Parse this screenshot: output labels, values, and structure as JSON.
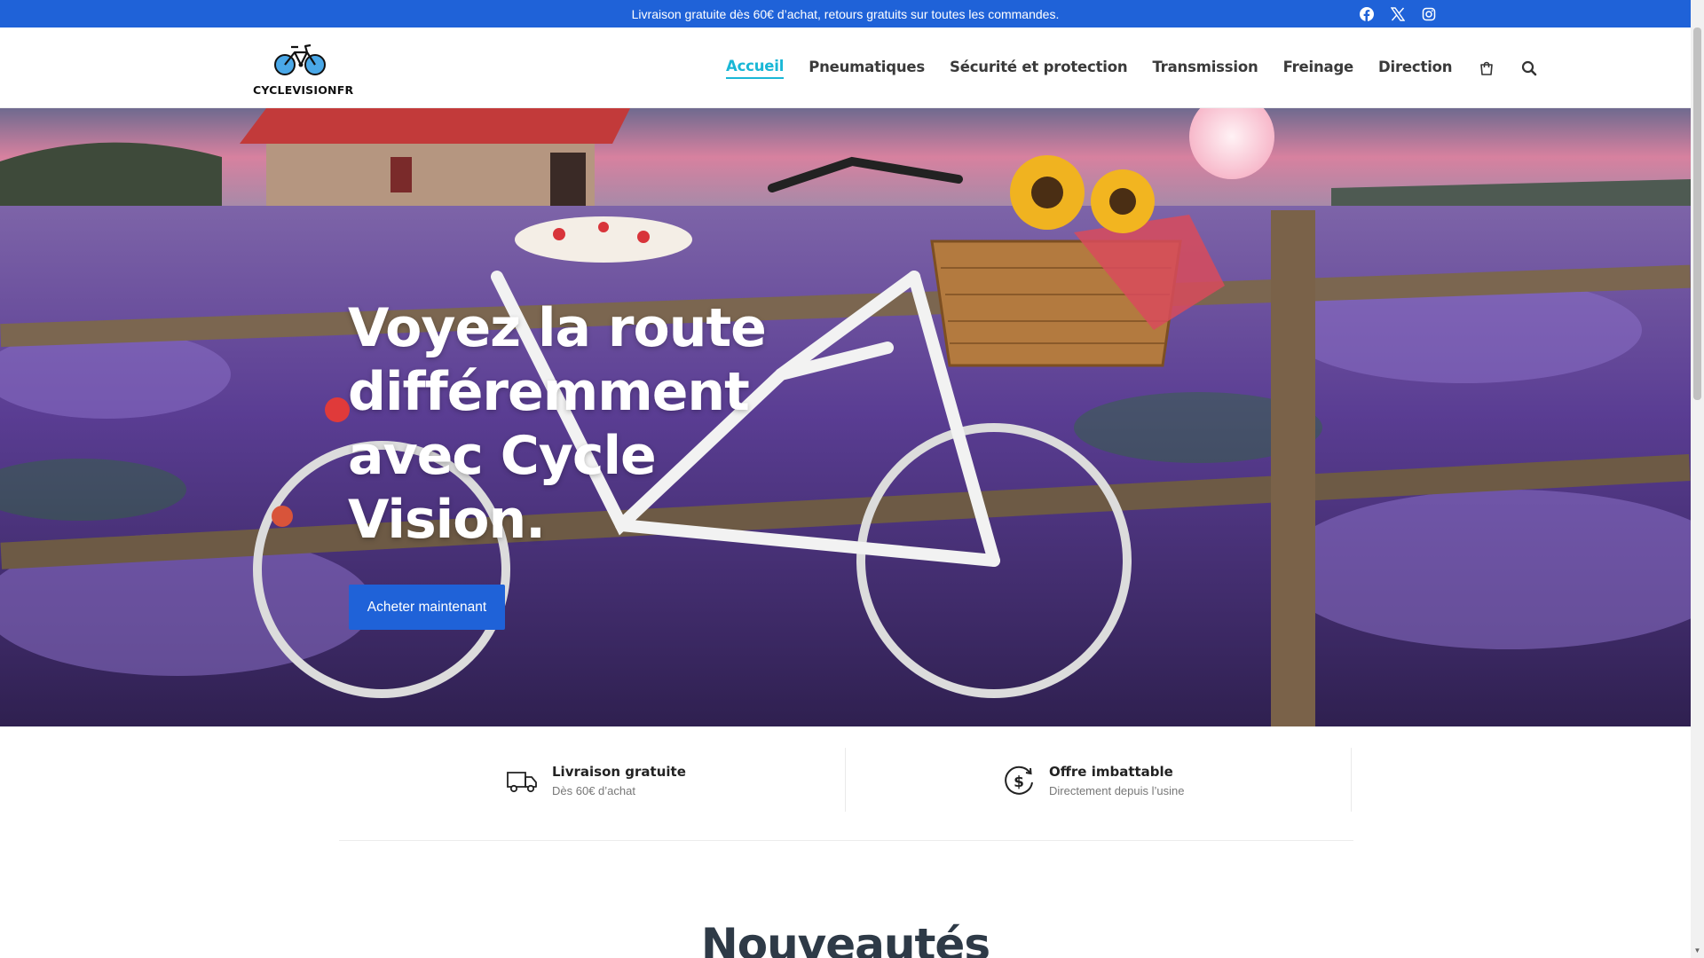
{
  "announcement": {
    "text": "Livraison gratuite dès 60€ d’achat, retours gratuits sur toutes les commandes."
  },
  "social": [
    "facebook-icon",
    "x-twitter-icon",
    "instagram-icon"
  ],
  "brand": {
    "name": "CYCLEVISIONFR"
  },
  "nav": {
    "items": [
      {
        "label": "Accueil",
        "active": true
      },
      {
        "label": "Pneumatiques"
      },
      {
        "label": "Sécurité et protection"
      },
      {
        "label": "Transmission"
      },
      {
        "label": "Freinage"
      },
      {
        "label": "Direction"
      }
    ],
    "icons": [
      "cart-icon",
      "search-icon"
    ]
  },
  "hero": {
    "title": "Voyez la route différemment avec Cycle Vision.",
    "cta": "Acheter maintenant"
  },
  "features": [
    {
      "title": "Livraison gratuite",
      "subtitle": "Dès 60€ d’achat",
      "icon": "delivery-truck-icon"
    },
    {
      "title": "Offre imbattable",
      "subtitle": "Directement depuis l’usine",
      "icon": "dollar-refresh-icon"
    }
  ],
  "section": {
    "title": "Nouveautés"
  },
  "colors": {
    "primary": "#1f62d8",
    "nav_active": "#19b7d6",
    "heading": "#2e3a47"
  }
}
